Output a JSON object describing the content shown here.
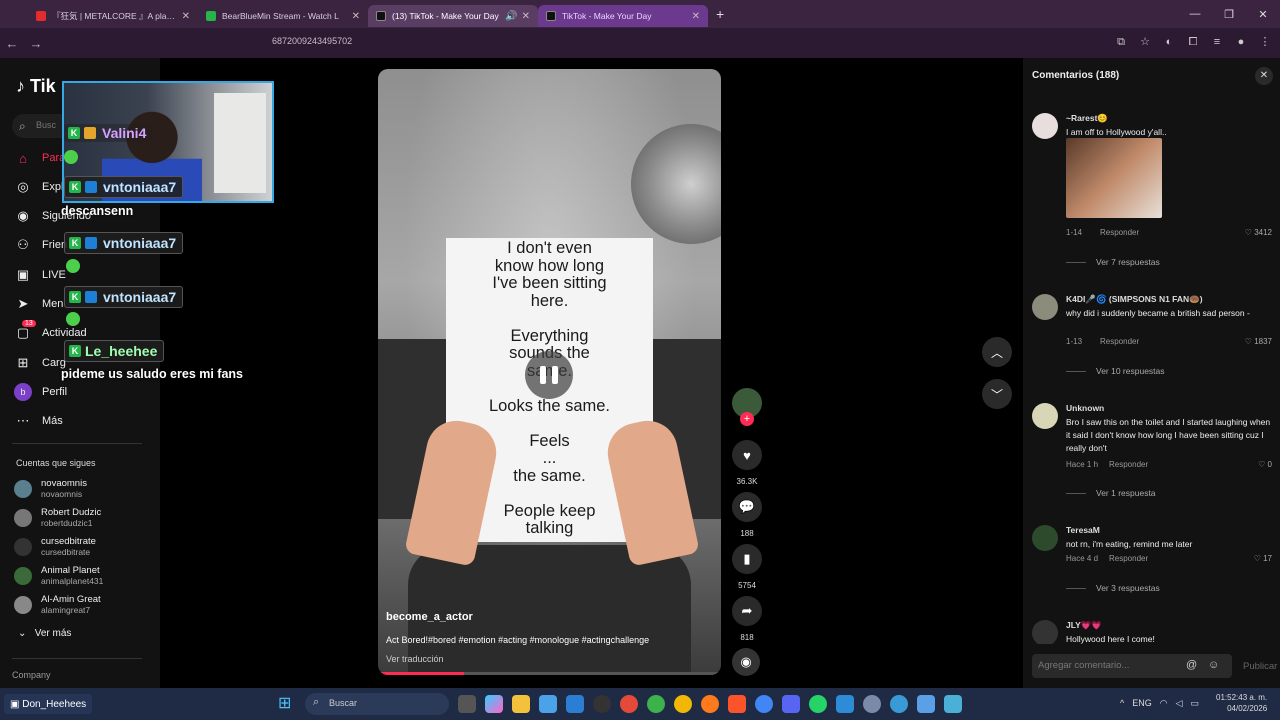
{
  "browser": {
    "tabs": [
      {
        "title": "『狂気 | METALCORE 』A playlist",
        "color": "#e52b2b"
      },
      {
        "title": "BearBlueMin Stream - Watch L",
        "color": "#25b54a"
      },
      {
        "title": "(13) TikTok - Make Your Day",
        "color": "#111111"
      },
      {
        "title": "TikTok - Make Your Day",
        "color": "#111111"
      }
    ],
    "url": "6872009243495702"
  },
  "tiktok": {
    "logo": "Tik",
    "search_placeholder": "Busc",
    "nav": [
      {
        "label": "Para",
        "icon": "home-icon"
      },
      {
        "label": "Explo",
        "icon": "compass-icon"
      },
      {
        "label": "Siguiendo",
        "icon": "following-icon"
      },
      {
        "label": "Frien",
        "icon": "friends-icon"
      },
      {
        "label": "LIVE",
        "icon": "live-icon"
      },
      {
        "label": "Men",
        "icon": "messages-icon"
      },
      {
        "label": "Actividad",
        "icon": "activity-icon"
      },
      {
        "label": "Carg",
        "icon": "upload-icon"
      },
      {
        "label": "Perfil",
        "icon": "profile-icon"
      },
      {
        "label": "Más",
        "icon": "more-icon"
      }
    ],
    "activity_badge": "13",
    "following_title": "Cuentas que sigues",
    "following": [
      {
        "name": "novaomnis",
        "user": "novaomnis"
      },
      {
        "name": "Robert Dudzic",
        "user": "robertdudzic1"
      },
      {
        "name": "cursedbitrate",
        "user": "cursedbitrate"
      },
      {
        "name": "Animal Planet",
        "user": "animalplanet431"
      },
      {
        "name": "Al-Amin Great",
        "user": "alamingreat7"
      }
    ],
    "see_more": "Ver más",
    "company": "Company"
  },
  "stream_chat": [
    {
      "user": "Valini4"
    },
    {
      "user": "vntoniaaa7",
      "msg": "descansenn"
    },
    {
      "user": "vntoniaaa7"
    },
    {
      "user": "vntoniaaa7"
    },
    {
      "user": "Le_heehee",
      "msg": "pideme us saludo eres mi fans"
    }
  ],
  "video": {
    "paper_lines": [
      "I don't even",
      "know how long",
      "I've been sitting",
      "here.",
      "",
      "Everything",
      "sounds the",
      "same.",
      "",
      "Looks the same.",
      "",
      "Feels",
      "...",
      "the same.",
      "",
      "People keep",
      "talking"
    ],
    "author": "become_a_actor",
    "description": "Act Bored!#bored #emotion #acting #monologue #actingchallenge",
    "translate": "Ver traducción",
    "progress": 0.25,
    "likes": "36.3K",
    "comments": "188",
    "saves": "5754",
    "shares": "818"
  },
  "comments_panel": {
    "title": "Comentarios (188)",
    "input_placeholder": "Agregar comentario...",
    "post": "Publicar",
    "items": [
      {
        "user": "~Rarest😊",
        "text": "I am off to Hollywood y'all..",
        "date": "1-14",
        "reply": "Responder",
        "likes": "3412",
        "replies": "Ver 7 respuestas"
      },
      {
        "user": "K4DI🎤🌀 (SIMPSONS N1 FAN🍩)",
        "text": "why did i suddenly became a british sad person -",
        "date": "1-13",
        "reply": "Responder",
        "likes": "1837",
        "replies": "Ver 10 respuestas"
      },
      {
        "user": "Unknown",
        "text": "Bro I saw this on the toilet and I started laughing when it said I don't know how long I have been sitting cuz I really don't",
        "date": "Hace 1 h",
        "reply": "Responder",
        "likes": "0",
        "replies": "Ver 1 respuesta"
      },
      {
        "user": "TeresaM",
        "text": "not rn, i'm eating, remind me later",
        "date": "Hace 4 d",
        "reply": "Responder",
        "likes": "17",
        "replies": "Ver 3 respuestas"
      },
      {
        "user": "JLY💗💗",
        "text": "Hollywood here I come!"
      }
    ]
  },
  "taskbar": {
    "user": "Don_Heehees",
    "search": "Buscar",
    "lang": "ENG",
    "time": "01:52:43 a. m.",
    "date": "04/02/2026"
  }
}
